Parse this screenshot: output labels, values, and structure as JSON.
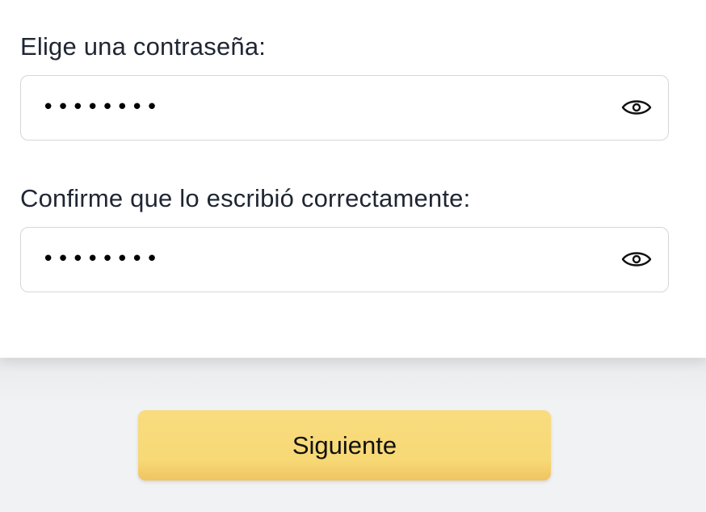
{
  "form": {
    "password_label": "Elige una contraseña:",
    "password_value": "••••••••",
    "confirm_label": "Confirme que lo escribió correctamente:",
    "confirm_value": "••••••••",
    "toggle_icon": "eye-icon"
  },
  "footer": {
    "next_label": "Siguiente"
  },
  "colors": {
    "button": "#f7d976",
    "label_text": "#1f2633",
    "input_border": "#d4d6da",
    "page_background": "#f1f2f4"
  }
}
